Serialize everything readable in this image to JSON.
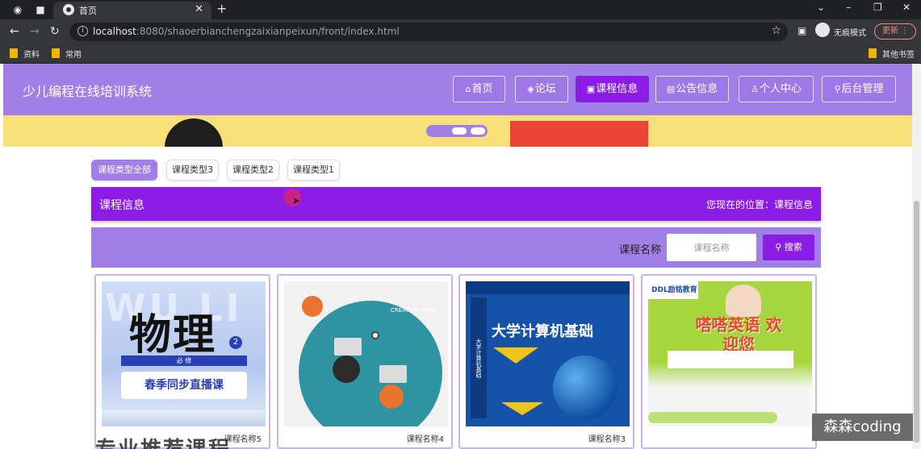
{
  "browser": {
    "tab_title": "首页",
    "url_host": "localhost",
    "url_rest": ":8080/shaoerbianchengzaixianpeixun/front/index.html",
    "incognito_label": "无痕模式",
    "update_label": "更新",
    "bookmarks": [
      "资料",
      "常用"
    ],
    "other_bookmarks": "其他书签"
  },
  "header": {
    "site_title": "少儿编程在线培训系统",
    "nav": [
      {
        "icon": "⌂",
        "label": "首页"
      },
      {
        "icon": "◈",
        "label": "论坛"
      },
      {
        "icon": "▣",
        "label": "课程信息"
      },
      {
        "icon": "▤",
        "label": "公告信息"
      },
      {
        "icon": "♙",
        "label": "个人中心"
      },
      {
        "icon": "⚲",
        "label": "后台管理"
      }
    ],
    "active_nav": "课程信息"
  },
  "filters": [
    "课程类型全部",
    "课程类型3",
    "课程类型2",
    "课程类型1"
  ],
  "info_bar": {
    "title": "课程信息",
    "location": "您现在的位置：课程信息"
  },
  "search": {
    "label": "课程名称",
    "placeholder": "课程名称",
    "button": "搜索"
  },
  "courses": [
    {
      "name": "课程名称5",
      "cover_title": "物理",
      "cover_num": "2",
      "cover_band": "必 修",
      "cover_sub": "春季同步直播课",
      "cover_bg": "WU LI"
    },
    {
      "name": "课程名称4",
      "cover_title": "CREATIVE TEAM"
    },
    {
      "name": "课程名称3",
      "cover_title": "大学计算机基础",
      "cover_spine": "大学计算机基础"
    },
    {
      "name": "",
      "cover_logo": "DDL励铭教育",
      "cover_title": "嗒嗒英语 欢迎您"
    }
  ],
  "bottom_heading": "专业推荐课程",
  "watermark": "森森coding",
  "colors": {
    "primary": "#a07fe6",
    "accent": "#8a1ce6",
    "banner": "#f7e07a"
  }
}
